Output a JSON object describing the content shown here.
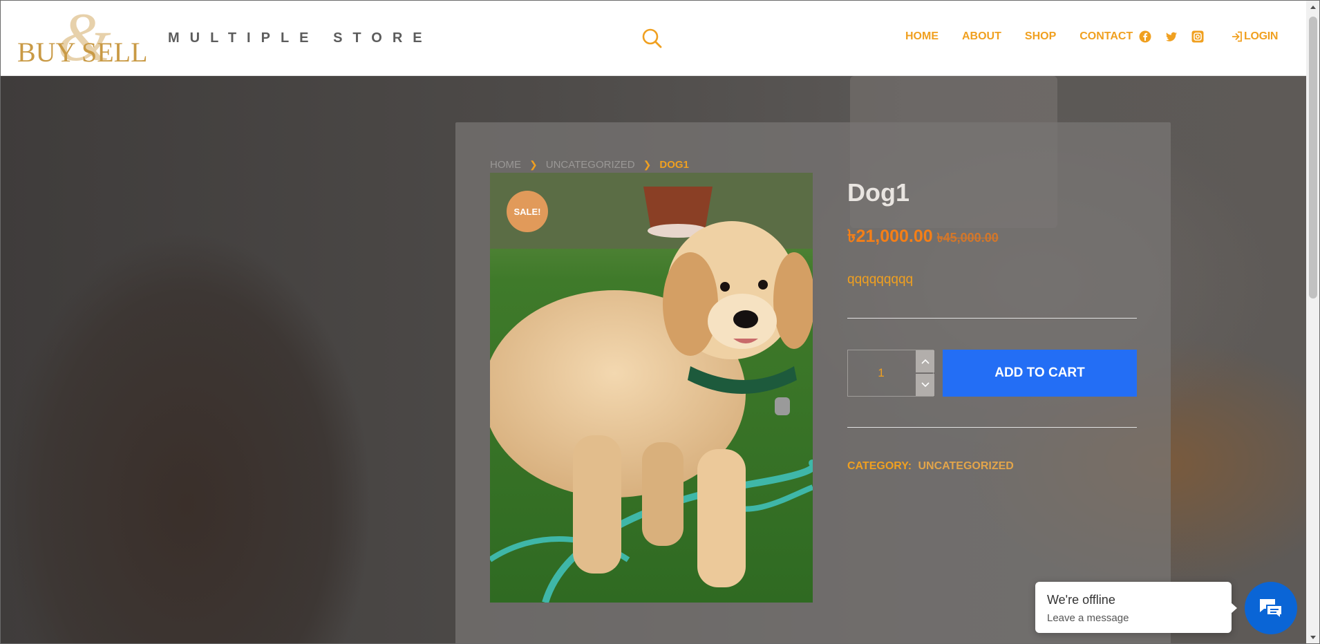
{
  "header": {
    "logo_text": "BUY SELL",
    "logo_amp": "&",
    "tagline": "MULTIPLE STORE",
    "nav": [
      {
        "label": "HOME"
      },
      {
        "label": "ABOUT"
      },
      {
        "label": "SHOP"
      },
      {
        "label": "CONTACT"
      }
    ],
    "social_icons": [
      "facebook-icon",
      "twitter-icon",
      "instagram-icon"
    ],
    "login_label": "LOGIN"
  },
  "breadcrumb": {
    "items": [
      "HOME",
      "UNCATEGORIZED"
    ],
    "current": "DOG1"
  },
  "product": {
    "sale_badge": "SALE!",
    "title": "Dog1",
    "price_new": "৳21,000.00",
    "price_old": "৳45,000.00",
    "description": "qqqqqqqqq",
    "quantity": "1",
    "add_to_cart_label": "ADD TO CART",
    "category_label": "CATEGORY:",
    "category_value": "UNCATEGORIZED"
  },
  "chat": {
    "title": "We're offline",
    "subtitle": "Leave a message"
  },
  "colors": {
    "accent": "#f0a020",
    "price": "#f57f17",
    "button": "#236ef5",
    "chat": "#0a65d6",
    "sale_badge": "#e19a5a"
  }
}
